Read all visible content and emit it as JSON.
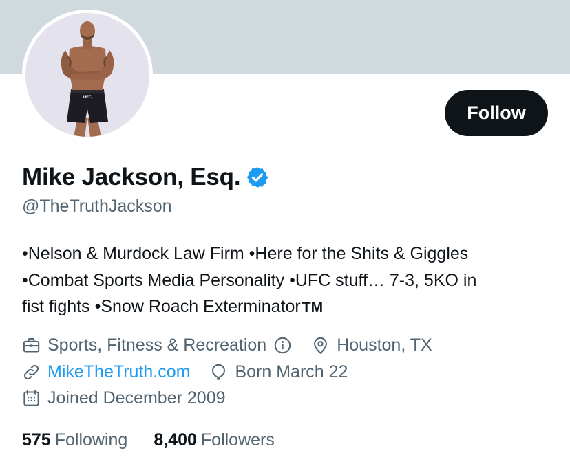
{
  "profile": {
    "display_name": "Mike Jackson, Esq.",
    "handle": "@TheTruthJackson",
    "follow_label": "Follow",
    "bio_lines": [
      "•Nelson & Murdock Law Firm •Here for the Shits & Giggles",
      "•Combat Sports Media Personality •UFC stuff… 7-3, 5KO in",
      "fist fights •Snow Roach Exterminator"
    ],
    "bio_tm": "TM",
    "category": "Sports, Fitness & Recreation",
    "location": "Houston, TX",
    "website": "MikeTheTruth.com",
    "birthday": "Born March 22",
    "joined": "Joined December 2009",
    "following_count": "575",
    "following_label": "Following",
    "followers_count": "8,400",
    "followers_label": "Followers"
  },
  "icons": {
    "verified": "verified-badge-icon",
    "category": "briefcase-icon",
    "info": "info-icon",
    "location": "location-pin-icon",
    "website": "link-icon",
    "birthday": "balloon-icon",
    "joined": "calendar-icon"
  },
  "colors": {
    "banner": "#cfd9de",
    "follow_button": "#0f1419",
    "link": "#1d9bf0",
    "verified": "#1d9bf0",
    "secondary_text": "#536471"
  }
}
